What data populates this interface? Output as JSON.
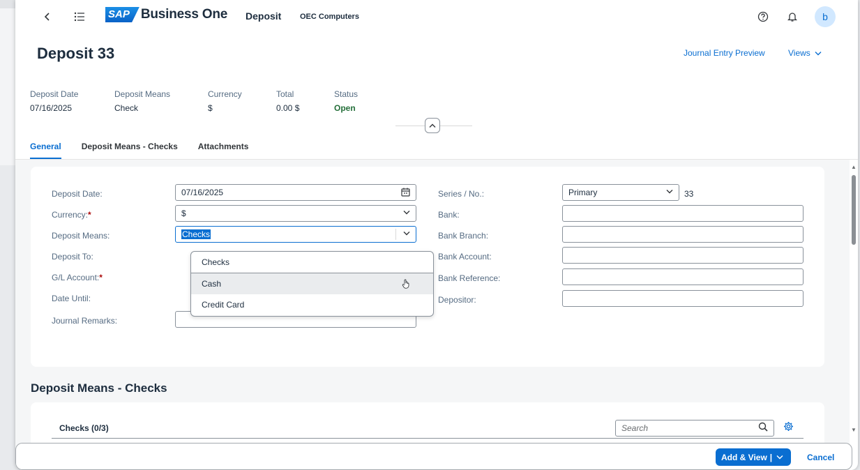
{
  "shell": {
    "logo_sap": "SAP",
    "logo_product": "Business One",
    "title": "Deposit",
    "company": "OEC Computers",
    "avatar_initial": "b",
    "icons": {
      "back": "chevron-left-icon",
      "menu": "list-icon",
      "help": "help-icon",
      "notifications": "bell-icon"
    }
  },
  "header": {
    "title": "Deposit 33",
    "journal_preview": "Journal Entry Preview",
    "views": "Views"
  },
  "kpis": [
    {
      "label": "Deposit Date",
      "value": "07/16/2025"
    },
    {
      "label": "Deposit Means",
      "value": "Check"
    },
    {
      "label": "Currency",
      "value": "$"
    },
    {
      "label": "Total",
      "value": "0.00 $"
    },
    {
      "label": "Status",
      "value": "Open"
    }
  ],
  "tabs": [
    {
      "label": "General",
      "active": true
    },
    {
      "label": "Deposit Means - Checks",
      "active": false
    },
    {
      "label": "Attachments",
      "active": false
    }
  ],
  "form_left": {
    "deposit_date": {
      "label": "Deposit Date:",
      "value": "07/16/2025"
    },
    "currency": {
      "label": "Currency:",
      "value": "$",
      "required": "*"
    },
    "deposit_means": {
      "label": "Deposit Means:",
      "value": "Checks"
    },
    "deposit_to": {
      "label": "Deposit To:"
    },
    "gl_account": {
      "label": "G/L Account:",
      "required": "*"
    },
    "date_until": {
      "label": "Date Until:"
    },
    "journal_remarks": {
      "label": "Journal Remarks:",
      "value": ""
    }
  },
  "form_right": {
    "series": {
      "label": "Series / No.:",
      "value": "Primary",
      "number": "33"
    },
    "bank": {
      "label": "Bank:",
      "value": ""
    },
    "bank_branch": {
      "label": "Bank Branch:",
      "value": ""
    },
    "bank_account": {
      "label": "Bank Account:",
      "value": ""
    },
    "bank_reference": {
      "label": "Bank Reference:",
      "value": ""
    },
    "depositor": {
      "label": "Depositor:",
      "value": ""
    }
  },
  "dropdown": {
    "options": [
      "Checks",
      "Cash",
      "Credit Card"
    ],
    "selected": "Checks",
    "hovered": "Cash"
  },
  "checks_section": {
    "title": "Deposit Means - Checks",
    "table_title": "Checks (0/3)",
    "search_placeholder": "Search"
  },
  "footer": {
    "primary": "Add & View",
    "cancel": "Cancel"
  },
  "colors": {
    "accent": "#0a6ed1",
    "status_open": "#256f3a",
    "required": "#aa0808"
  }
}
